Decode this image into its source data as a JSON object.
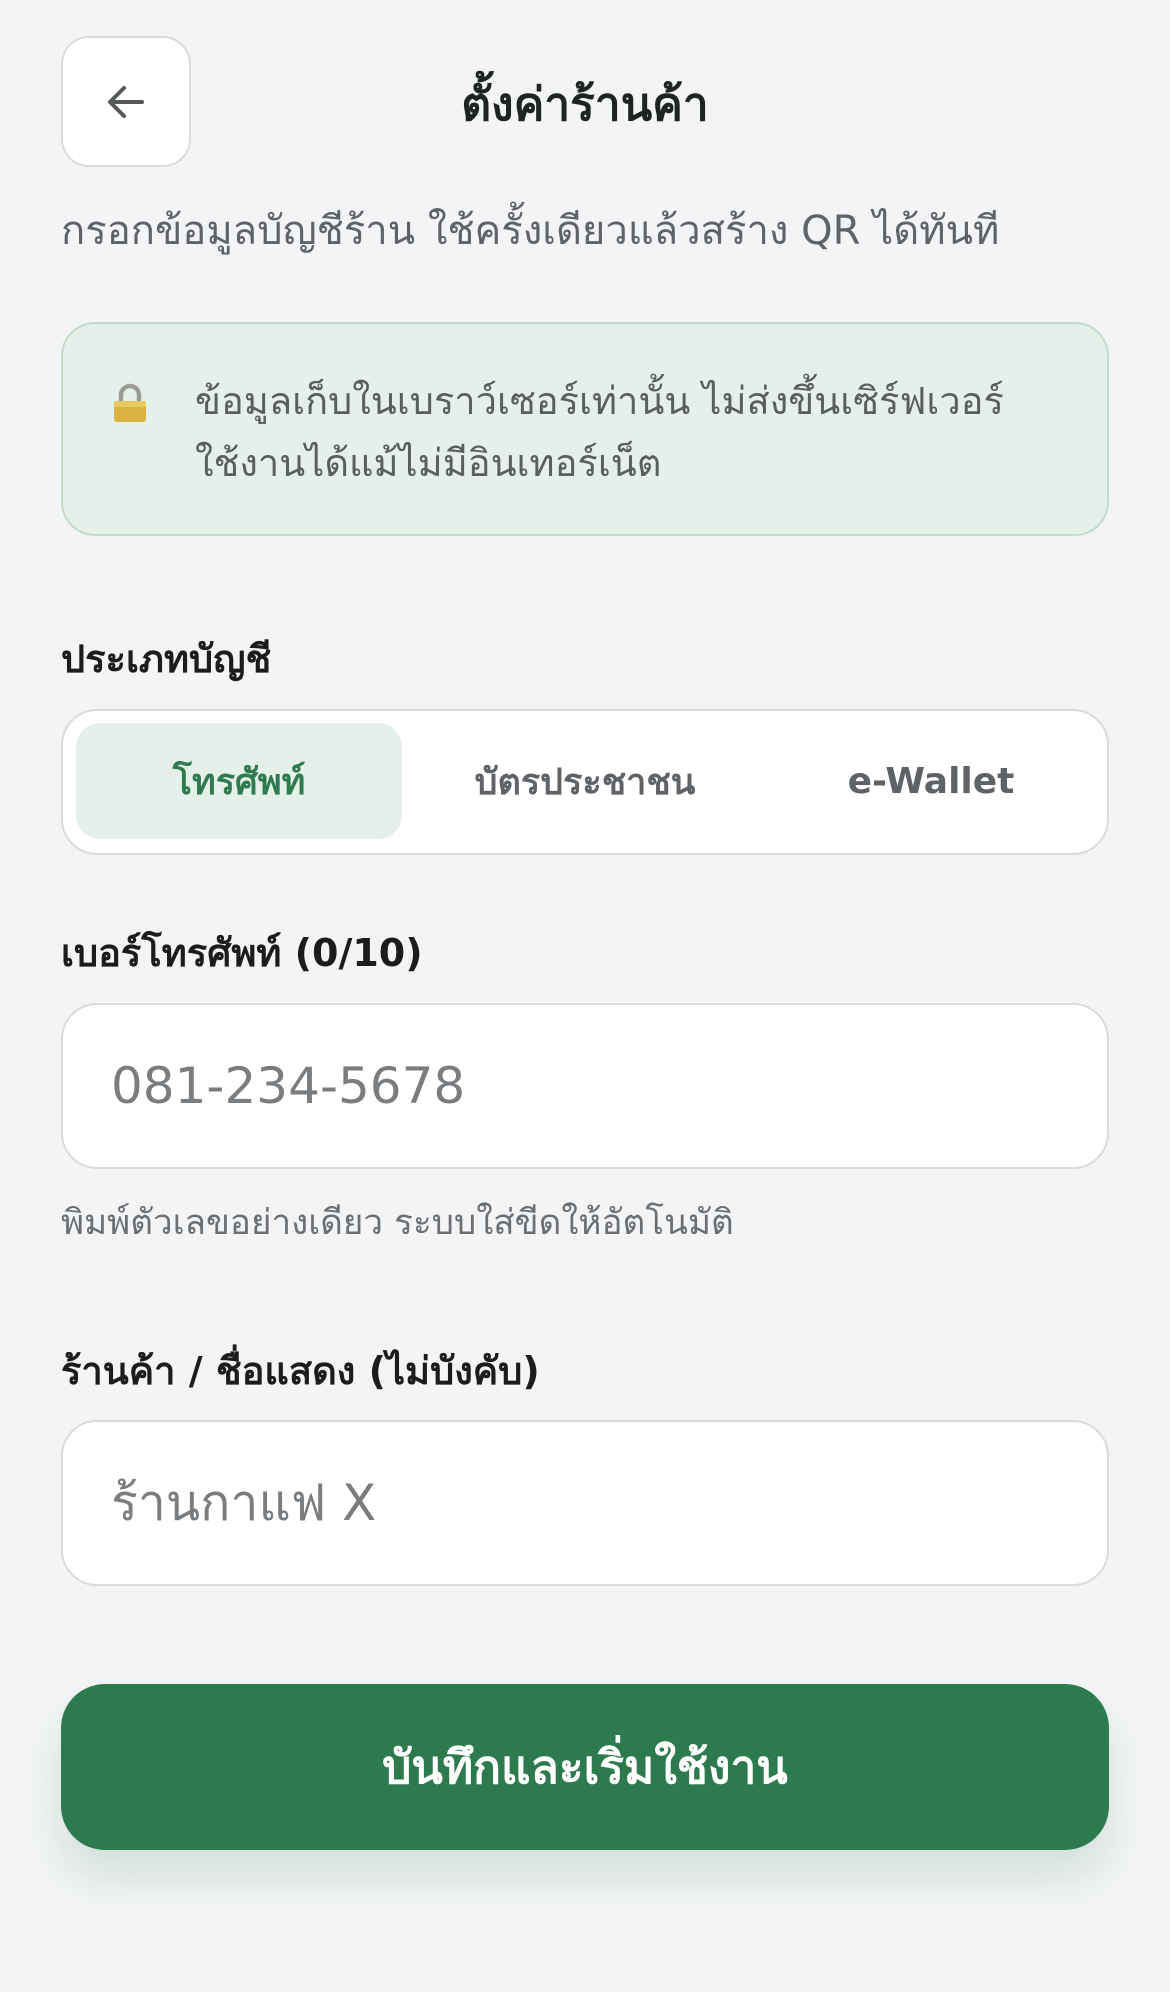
{
  "header": {
    "title": "ตั้งค่าร้านค้า",
    "back_icon": "arrow-left-icon",
    "subtitle": "กรอกข้อมูลบัญชีร้าน ใช้ครั้งเดียวแล้วสร้าง QR ได้ทันที"
  },
  "notice": {
    "icon": "lock-icon",
    "line1": "ข้อมูลเก็บในเบราว์เซอร์เท่านั้น ไม่ส่งขึ้นเซิร์ฟเวอร์",
    "line2": "ใช้งานได้แม้ไม่มีอินเทอร์เน็ต"
  },
  "account_type": {
    "label": "ประเภทบัญชี",
    "options": [
      "โทรศัพท์",
      "บัตรประชาชน",
      "e-Wallet"
    ],
    "selected": "โทรศัพท์"
  },
  "phone": {
    "label": "เบอร์โทรศัพท์ (0/10)",
    "value": "",
    "placeholder": "081-234-5678",
    "hint": "พิมพ์ตัวเลขอย่างเดียว ระบบใส่ขีดให้อัตโนมัติ"
  },
  "shop_name": {
    "label": "ร้านค้า / ชื่อแสดง (ไม่บังคับ)",
    "value": "",
    "placeholder": "ร้านกาแฟ X"
  },
  "submit": {
    "label": "บันทึกและเริ่มใช้งาน"
  },
  "colors": {
    "accent": "#2e7a4f",
    "background": "#f3f4f6",
    "notice_bg": "#e6f0ea"
  }
}
